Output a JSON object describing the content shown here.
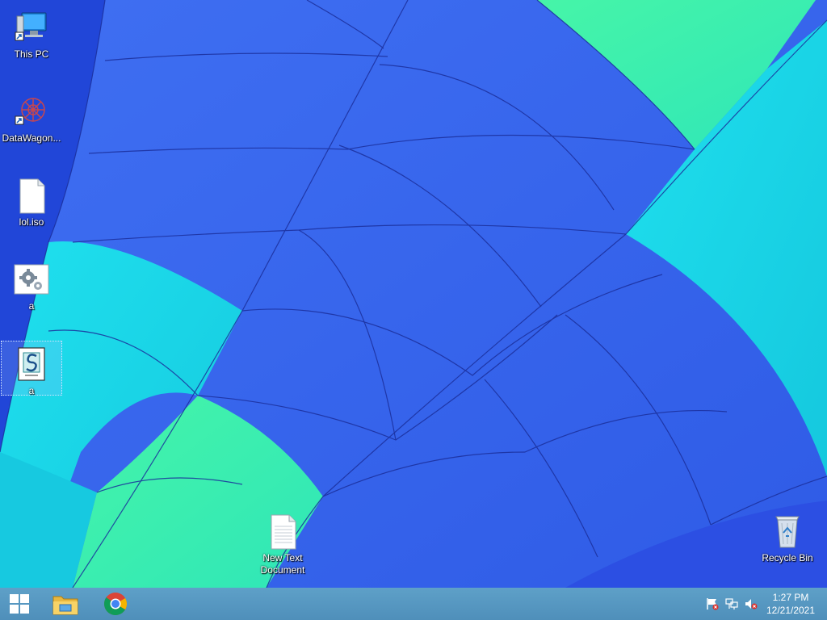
{
  "desktop": {
    "icons": [
      {
        "label": "This PC",
        "icon": "this-pc-icon"
      },
      {
        "label": "DataWagon...",
        "icon": "datawagon-icon"
      },
      {
        "label": "lol.iso",
        "icon": "file-icon"
      },
      {
        "label": "a",
        "icon": "settings-file-icon"
      },
      {
        "label": "a",
        "icon": "script-file-icon",
        "selected": true
      },
      {
        "label": "New Text Document",
        "icon": "text-document-icon"
      },
      {
        "label": "Recycle Bin",
        "icon": "recycle-bin-icon"
      }
    ]
  },
  "taskbar": {
    "pinned": [
      "start-icon",
      "file-explorer-icon",
      "chrome-icon"
    ],
    "tray": [
      "action-center-flag-icon",
      "network-icon",
      "volume-muted-icon"
    ],
    "clock": {
      "time": "1:27 PM",
      "date": "12/21/2021"
    }
  },
  "colors": {
    "taskbar": "#5295c3",
    "wallpaper_blue": "#3b6cf0",
    "wallpaper_cyan": "#19d6e6",
    "wallpaper_green": "#3ff2a8"
  }
}
